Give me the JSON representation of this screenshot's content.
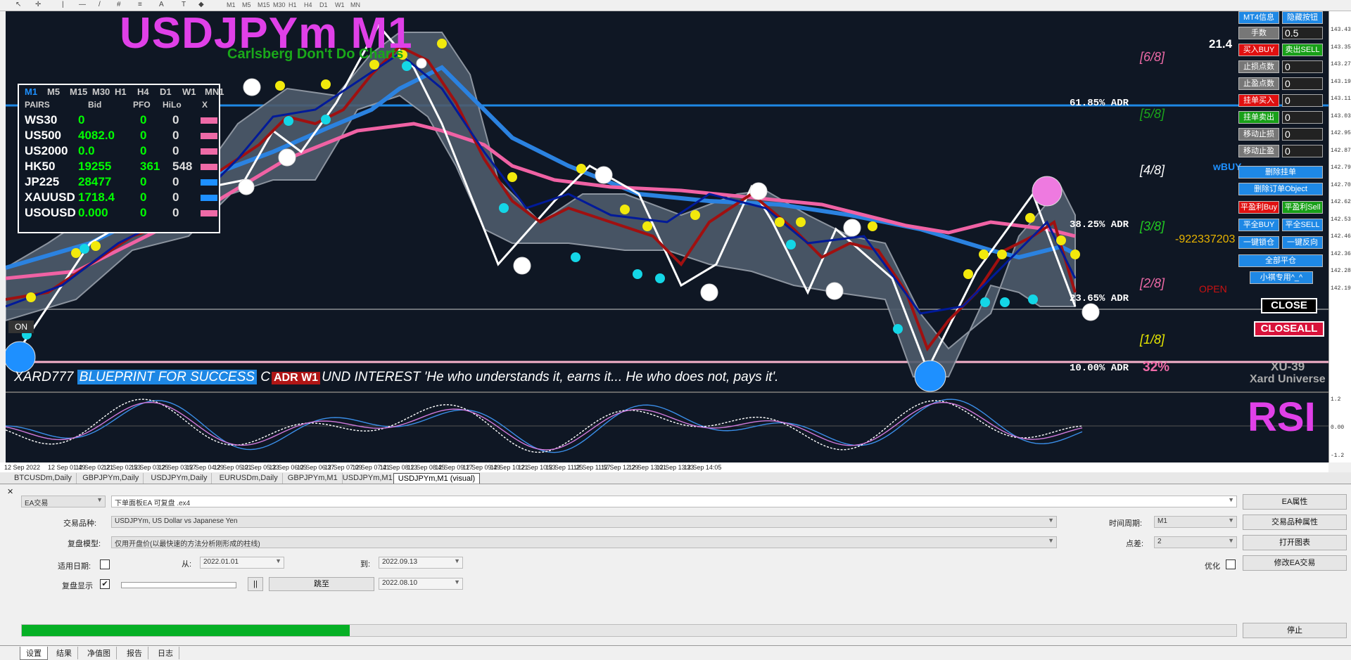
{
  "toolbar": {
    "timeframes": [
      "M1",
      "M5",
      "M15",
      "M30",
      "H1",
      "H4",
      "D1",
      "W1",
      "MN"
    ]
  },
  "chart": {
    "title": "USDJPYm M1",
    "subtitle": "Carlsberg Don't Do Charts",
    "pairs_box": {
      "timeframes": [
        "M1",
        "M5",
        "M15",
        "M30",
        "H1",
        "H4",
        "D1",
        "W1",
        "MN1"
      ],
      "headers": {
        "pairs": "PAIRS",
        "bid": "Bid",
        "pfo": "PFO",
        "hilo": "HiLo",
        "x": "X"
      },
      "rows": [
        {
          "sym": "WS30",
          "bid": "0",
          "pfo": "0",
          "hilo": "0",
          "x": "#ee6aa7"
        },
        {
          "sym": "US500",
          "bid": "4082.0",
          "pfo": "0",
          "hilo": "0",
          "x": "#ee6aa7"
        },
        {
          "sym": "US2000",
          "bid": "0.0",
          "pfo": "0",
          "hilo": "0",
          "x": "#ee6aa7"
        },
        {
          "sym": "HK50",
          "bid": "19255",
          "pfo": "361",
          "hilo": "548",
          "x": "#ee6aa7"
        },
        {
          "sym": "JP225",
          "bid": "28477",
          "pfo": "0",
          "hilo": "0",
          "x": "#1e90ff"
        },
        {
          "sym": "XAUUSD",
          "bid": "1718.4",
          "pfo": "0",
          "hilo": "0",
          "x": "#1e90ff"
        },
        {
          "sym": "USOUSD",
          "bid": "0.000",
          "pfo": "0",
          "hilo": "0",
          "x": "#ee6aa7"
        }
      ]
    },
    "adr_labels": [
      "61.85% ADR",
      "38.25% ADR",
      "23.65% ADR",
      "10.00% ADR"
    ],
    "adr_percent": "32%",
    "murrey_levels": [
      "[6/8]",
      "[5/8]",
      "[4/8]",
      "[3/8]",
      "[2/8]",
      "[1/8]"
    ],
    "top_number": "21.4",
    "wbuy_label": "wBUY",
    "big_number": "-922337203",
    "open_label": "OPEN",
    "on_label": "ON",
    "banner": {
      "prefix": "XARD777",
      "highlight": "BLUEPRINT FOR SUCCESS",
      "partial": "C",
      "badge": "ADR W1",
      "rest": "UND INTEREST 'He who understands it, earns it... He who does not, pays it'."
    },
    "brand": {
      "line1": "XU-39",
      "line2": "Xard Universe"
    },
    "rsi_label": "RSI",
    "close_buttons": {
      "close": "CLOSE",
      "closeall": "CLOSEALL"
    },
    "panel": {
      "top": [
        {
          "label": "MT4信息",
          "color": "#1e88e5"
        },
        {
          "label": "隐藏按钮",
          "color": "#1e88e5"
        }
      ],
      "rows": [
        {
          "label": "手数",
          "color": "#777",
          "value": "0.5"
        },
        {
          "label": "买入BUY",
          "color": "#e01010",
          "value": "",
          "side": "卖出SELL",
          "side_color": "#18a018"
        },
        {
          "label": "止损点数",
          "color": "#777",
          "value": "0"
        },
        {
          "label": "止盈点数",
          "color": "#777",
          "value": "0"
        },
        {
          "label": "挂单买入",
          "color": "#e01010",
          "value": "0"
        },
        {
          "label": "挂单卖出",
          "color": "#18a018",
          "value": "0"
        },
        {
          "label": "移动止损",
          "color": "#777",
          "value": "0"
        },
        {
          "label": "移动止盈",
          "color": "#777",
          "value": "0"
        }
      ],
      "wide": [
        {
          "label": "删除挂单",
          "color": "#1e88e5"
        },
        {
          "label": "删除订单Object",
          "color": "#1e88e5"
        }
      ],
      "pairs": [
        [
          {
            "label": "平盈利Buy",
            "color": "#e01010"
          },
          {
            "label": "平盈利Sell",
            "color": "#18a018"
          }
        ],
        [
          {
            "label": "平全BUY",
            "color": "#1e88e5"
          },
          {
            "label": "平全SELL",
            "color": "#1e88e5"
          }
        ],
        [
          {
            "label": "一键锁仓",
            "color": "#1e88e5"
          },
          {
            "label": "一键反向",
            "color": "#1e88e5"
          }
        ]
      ],
      "all_close": {
        "label": "全部平仓",
        "color": "#1e88e5"
      },
      "special": {
        "label": "小祺专用^_^",
        "color": "#1e88e5"
      }
    }
  },
  "price_axis": [
    "143.43",
    "143.35",
    "143.27",
    "143.19",
    "143.11",
    "143.03",
    "142.95",
    "142.87",
    "142.79",
    "142.70",
    "142.62",
    "142.53",
    "142.46",
    "142.36",
    "142.28",
    "142.19"
  ],
  "rsi_axis": [
    "1.2",
    "0.00",
    "-1.2"
  ],
  "time_axis": [
    "12 Sep 2022",
    "12 Sep 01:49",
    "12 Sep 02:21",
    "12 Sep 02:53",
    "12 Sep 03:25",
    "12 Sep 03:57",
    "12 Sep 04:29",
    "12 Sep 05:01",
    "12 Sep 05:33",
    "12 Sep 06:05",
    "12 Sep 06:37",
    "12 Sep 07:09",
    "12 Sep 07:41",
    "12 Sep 08:13",
    "12 Sep 08:45",
    "12 Sep 09:17",
    "12 Sep 09:49",
    "12 Sep 10:21",
    "12 Sep 10:53",
    "12 Sep 11:25",
    "12 Sep 11:57",
    "12 Sep 12:29",
    "12 Sep 13:01",
    "12 Sep 13:33",
    "12 Sep 14:05"
  ],
  "chart_tabs": [
    "BTCUSDm,Daily",
    "GBPJPYm,Daily",
    "USDJPYm,Daily",
    "EURUSDm,Daily",
    "GBPJPYm,M1",
    "USDJPYm,M1",
    "USDJPYm,M1 (visual)"
  ],
  "active_chart_tab": 6,
  "tester": {
    "ea_type": "EA交易",
    "ea_file": "下单面板EA 可复盘 .ex4",
    "symbol_label": "交易品种:",
    "symbol_value": "USDJPYm, US Dollar vs Japanese Yen",
    "model_label": "复盘模型:",
    "model_value": "仅用开盘价(以最快速的方法分析刚形成的柱线)",
    "use_date_label": "适用日期:",
    "from_label": "从:",
    "from_value": "2022.01.01",
    "to_label": "到:",
    "to_value": "2022.09.13",
    "visual_label": "复盘显示",
    "pause_label": "||",
    "skip_label": "跳至",
    "skip_date": "2022.08.10",
    "period_label": "时间周期:",
    "period_value": "M1",
    "spread_label": "点差:",
    "spread_value": "2",
    "optimize_label": "优化",
    "btn_ea_props": "EA属性",
    "btn_symbol_props": "交易品种属性",
    "btn_open_chart": "打开图表",
    "btn_modify_ea": "修改EA交易",
    "btn_stop": "停止",
    "progress": 0.27
  },
  "bottom_tabs": [
    "设置",
    "结果",
    "净值图",
    "报告",
    "日志"
  ],
  "active_bottom_tab": 0
}
